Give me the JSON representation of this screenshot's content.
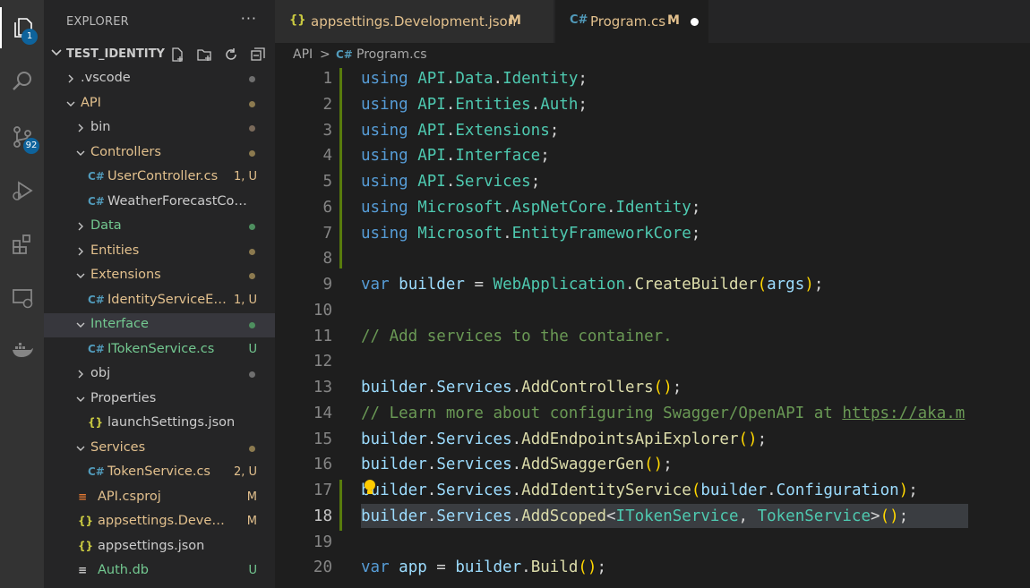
{
  "activity_bar": {
    "explorer_badge": "1",
    "scm_badge": "92",
    "icons": [
      "files-icon",
      "search-icon",
      "source-control-icon",
      "run-debug-icon",
      "extensions-icon",
      "remote-explorer-icon",
      "docker-icon"
    ]
  },
  "sidebar": {
    "title": "EXPLORER",
    "more": "···",
    "root": "TEST_IDENTITY",
    "items": [
      {
        "label": ".vscode",
        "deco": "",
        "color": "#cccccc",
        "icon": ""
      },
      {
        "label": "API",
        "deco": "",
        "color": "#e2c08d",
        "icon": ""
      },
      {
        "label": "bin",
        "deco": "",
        "color": "#cccccc",
        "icon": ""
      },
      {
        "label": "Controllers",
        "deco": "",
        "color": "#e2c08d",
        "icon": ""
      },
      {
        "label": "UserController.cs",
        "deco": "1, U",
        "color": "#e2c08d",
        "icon": "C#"
      },
      {
        "label": "WeatherForecastControll...",
        "deco": "",
        "color": "#cccccc",
        "icon": "C#"
      },
      {
        "label": "Data",
        "deco": "",
        "color": "#73c991",
        "icon": ""
      },
      {
        "label": "Entities",
        "deco": "",
        "color": "#e2c08d",
        "icon": ""
      },
      {
        "label": "Extensions",
        "deco": "",
        "color": "#e2c08d",
        "icon": ""
      },
      {
        "label": "IdentityServiceExt...",
        "deco": "1, U",
        "color": "#e2c08d",
        "icon": "C#"
      },
      {
        "label": "Interface",
        "deco": "",
        "color": "#73c991",
        "icon": ""
      },
      {
        "label": "ITokenService.cs",
        "deco": "U",
        "color": "#73c991",
        "icon": "C#"
      },
      {
        "label": "obj",
        "deco": "",
        "color": "#cccccc",
        "icon": ""
      },
      {
        "label": "Properties",
        "deco": "",
        "color": "#cccccc",
        "icon": ""
      },
      {
        "label": "launchSettings.json",
        "deco": "",
        "color": "#cccccc",
        "icon": "{}"
      },
      {
        "label": "Services",
        "deco": "",
        "color": "#e2c08d",
        "icon": ""
      },
      {
        "label": "TokenService.cs",
        "deco": "2, U",
        "color": "#e2c08d",
        "icon": "C#"
      },
      {
        "label": "API.csproj",
        "deco": "M",
        "color": "#e2c08d",
        "icon": "rss"
      },
      {
        "label": "appsettings.Develop...",
        "deco": "M",
        "color": "#e2c08d",
        "icon": "{}"
      },
      {
        "label": "appsettings.json",
        "deco": "",
        "color": "#cccccc",
        "icon": "{}"
      },
      {
        "label": "Auth.db",
        "deco": "U",
        "color": "#73c991",
        "icon": "db"
      }
    ]
  },
  "tabs": [
    {
      "icon": "{}",
      "label": "appsettings.Development.json",
      "status": "M"
    },
    {
      "icon": "C#",
      "label": "Program.cs",
      "status": "M"
    }
  ],
  "breadcrumb": {
    "folder": "API",
    "sep": ">",
    "icon": "C#",
    "file": "Program.cs"
  },
  "editor": {
    "line_numbers": [
      "1",
      "2",
      "3",
      "4",
      "5",
      "6",
      "7",
      "8",
      "9",
      "10",
      "11",
      "12",
      "13",
      "14",
      "15",
      "16",
      "17",
      "18",
      "19",
      "20"
    ],
    "current_line": "18",
    "lines": [
      "using API.Data.Identity;",
      "using API.Entities.Auth;",
      "using API.Extensions;",
      "using API.Interface;",
      "using API.Services;",
      "using Microsoft.AspNetCore.Identity;",
      "using Microsoft.EntityFrameworkCore;",
      "",
      "var builder = WebApplication.CreateBuilder(args);",
      "",
      "// Add services to the container.",
      "",
      "builder.Services.AddControllers();",
      "// Learn more about configuring Swagger/OpenAPI at https://aka.m",
      "builder.Services.AddEndpointsApiExplorer();",
      "builder.Services.AddSwaggerGen();",
      "builder.Services.AddIdentityService(builder.Configuration);",
      "builder.Services.AddScoped<ITokenService, TokenService>();",
      "",
      "var app = builder.Build();"
    ]
  }
}
